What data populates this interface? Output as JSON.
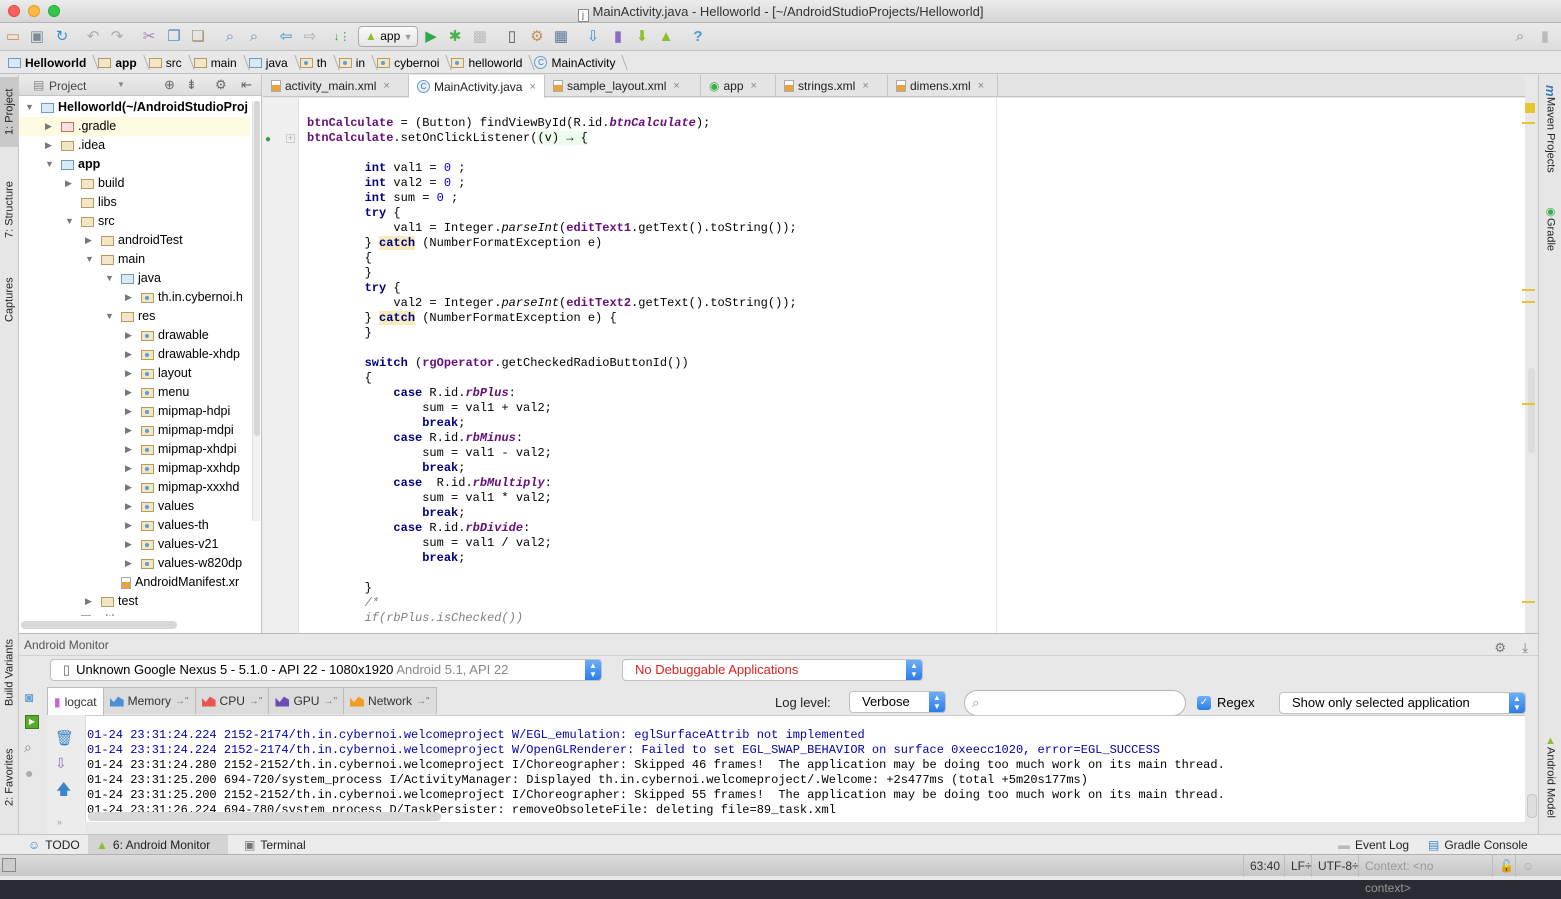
{
  "window": {
    "title": "MainActivity.java - Helloworld - [~/AndroidStudioProjects/Helloworld]",
    "traffic_lights": {
      "close": "#fc605c",
      "minimize": "#fdbc40",
      "maximize": "#34c84a"
    }
  },
  "toolbar": {
    "run_config": "app",
    "icons": [
      "open-folder-icon",
      "save-icon",
      "sync-icon",
      "undo-icon",
      "redo-icon",
      "cut-icon",
      "copy-icon",
      "paste-icon",
      "find-icon",
      "replace-icon",
      "back-icon",
      "forward-icon",
      "make-project-icon",
      "run-icon",
      "debug-icon",
      "coverage-icon",
      "attach-debugger-icon",
      "project-structure-icon",
      "sdk-manager-icon",
      "gradle-sync-icon",
      "avd-manager-icon",
      "android-device-monitor-icon",
      "android-icon",
      "help-icon",
      "search-everywhere-icon",
      "user-icon"
    ]
  },
  "breadcrumb": [
    "Helloworld",
    "app",
    "src",
    "main",
    "java",
    "th",
    "in",
    "cybernoi",
    "helloworld",
    "MainActivity"
  ],
  "project_panel": {
    "view_selector": "Project",
    "tree": [
      {
        "label": "Helloworld",
        "suffix": " (~/AndroidStudioProj",
        "depth": 0,
        "expanded": true,
        "bold": true,
        "icon": "module"
      },
      {
        "label": ".gradle",
        "depth": 1,
        "expanded": false,
        "icon": "folder-red",
        "selected": true
      },
      {
        "label": ".idea",
        "depth": 1,
        "expanded": false,
        "icon": "folder"
      },
      {
        "label": "app",
        "depth": 1,
        "expanded": true,
        "bold": true,
        "icon": "module"
      },
      {
        "label": "build",
        "depth": 2,
        "expanded": false,
        "icon": "folder"
      },
      {
        "label": "libs",
        "depth": 2,
        "expanded": null,
        "icon": "folder"
      },
      {
        "label": "src",
        "depth": 2,
        "expanded": true,
        "icon": "folder"
      },
      {
        "label": "androidTest",
        "depth": 3,
        "expanded": false,
        "icon": "folder"
      },
      {
        "label": "main",
        "depth": 3,
        "expanded": true,
        "icon": "folder"
      },
      {
        "label": "java",
        "depth": 4,
        "expanded": true,
        "icon": "folder-blue"
      },
      {
        "label": "th.in.cybernoi.h",
        "depth": 5,
        "expanded": false,
        "icon": "package"
      },
      {
        "label": "res",
        "depth": 4,
        "expanded": true,
        "icon": "folder-res"
      },
      {
        "label": "drawable",
        "depth": 5,
        "expanded": false,
        "icon": "package"
      },
      {
        "label": "drawable-xhdp",
        "depth": 5,
        "expanded": false,
        "icon": "package"
      },
      {
        "label": "layout",
        "depth": 5,
        "expanded": false,
        "icon": "package"
      },
      {
        "label": "menu",
        "depth": 5,
        "expanded": false,
        "icon": "package"
      },
      {
        "label": "mipmap-hdpi",
        "depth": 5,
        "expanded": false,
        "icon": "package"
      },
      {
        "label": "mipmap-mdpi",
        "depth": 5,
        "expanded": false,
        "icon": "package"
      },
      {
        "label": "mipmap-xhdpi",
        "depth": 5,
        "expanded": false,
        "icon": "package"
      },
      {
        "label": "mipmap-xxhdp",
        "depth": 5,
        "expanded": false,
        "icon": "package"
      },
      {
        "label": "mipmap-xxxhd",
        "depth": 5,
        "expanded": false,
        "icon": "package"
      },
      {
        "label": "values",
        "depth": 5,
        "expanded": false,
        "icon": "package"
      },
      {
        "label": "values-th",
        "depth": 5,
        "expanded": false,
        "icon": "package"
      },
      {
        "label": "values-v21",
        "depth": 5,
        "expanded": false,
        "icon": "package"
      },
      {
        "label": "values-w820dp",
        "depth": 5,
        "expanded": false,
        "icon": "package"
      },
      {
        "label": "AndroidManifest.xr",
        "depth": 4,
        "expanded": null,
        "icon": "xml"
      },
      {
        "label": "test",
        "depth": 3,
        "expanded": false,
        "icon": "folder"
      },
      {
        "label": ".gitignore",
        "depth": 2,
        "expanded": null,
        "icon": "file"
      }
    ]
  },
  "left_strip": [
    "1: Project",
    "7: Structure",
    "Captures",
    "Build Variants",
    "2: Favorites"
  ],
  "right_strip": [
    "Maven Projects",
    "Gradle",
    "Android Model"
  ],
  "editor": {
    "tabs": [
      {
        "label": "activity_main.xml",
        "icon": "xml",
        "active": false
      },
      {
        "label": "MainActivity.java",
        "icon": "class",
        "active": true
      },
      {
        "label": "sample_layout.xml",
        "icon": "xml",
        "active": false
      },
      {
        "label": "app",
        "icon": "gradle",
        "active": false
      },
      {
        "label": "strings.xml",
        "icon": "xml",
        "active": false
      },
      {
        "label": "dimens.xml",
        "icon": "xml",
        "active": false
      }
    ],
    "code_lines": [
      "btnCalculate = (Button) findViewById(R.id.btnCalculate);",
      "btnCalculate.setOnClickListener((v) → {",
      "",
      "        int val1 = 0 ;",
      "        int val2 = 0 ;",
      "        int sum = 0 ;",
      "        try {",
      "            val1 = Integer.parseInt(editText1.getText().toString());",
      "        } catch (NumberFormatException e)",
      "        {",
      "        }",
      "        try {",
      "            val2 = Integer.parseInt(editText2.getText().toString());",
      "        } catch (NumberFormatException e) {",
      "        }",
      "",
      "        switch (rgOperator.getCheckedRadioButtonId())",
      "        {",
      "            case R.id.rbPlus:",
      "                sum = val1 + val2;",
      "                break;",
      "            case R.id.rbMinus:",
      "                sum = val1 - val2;",
      "                break;",
      "            case  R.id.rbMultiply:",
      "                sum = val1 * val2;",
      "                break;",
      "            case R.id.rbDivide:",
      "                sum = val1 / val2;",
      "                break;",
      "",
      "        }",
      "        /*",
      "        if(rbPlus.isChecked())"
    ],
    "marker_color": "#e8c42f"
  },
  "android_monitor": {
    "title": "Android Monitor",
    "device": "Unknown Google Nexus 5 - 5.1.0 - API 22 - 1080x1920",
    "device_suffix": "Android 5.1, API 22",
    "process": "No Debuggable Applications",
    "process_color": "#e0231d",
    "tabs": [
      {
        "label": "logcat",
        "active": true
      },
      {
        "label": "Memory",
        "color": "#4a90d9"
      },
      {
        "label": "CPU",
        "color": "#e8574f"
      },
      {
        "label": "GPU",
        "color": "#6a4fb3"
      },
      {
        "label": "Network",
        "color": "#f39c1f"
      }
    ],
    "log_level_label": "Log level:",
    "log_level": "Verbose",
    "search_placeholder": "",
    "regex_label": "Regex",
    "regex_checked": true,
    "filter": "Show only selected application",
    "log_lines": [
      {
        "level": "W",
        "text": "01-24 23:31:24.224 2152-2174/th.in.cybernoi.welcomeproject W/EGL_emulation: eglSurfaceAttrib not implemented"
      },
      {
        "level": "W",
        "text": "01-24 23:31:24.224 2152-2174/th.in.cybernoi.welcomeproject W/OpenGLRenderer: Failed to set EGL_SWAP_BEHAVIOR on surface 0xeecc1020, error=EGL_SUCCESS"
      },
      {
        "level": "I",
        "text": "01-24 23:31:24.280 2152-2152/th.in.cybernoi.welcomeproject I/Choreographer: Skipped 46 frames!  The application may be doing too much work on its main thread."
      },
      {
        "level": "I",
        "text": "01-24 23:31:25.200 694-720/system_process I/ActivityManager: Displayed th.in.cybernoi.welcomeproject/.Welcome: +2s477ms (total +5m20s177ms)"
      },
      {
        "level": "I",
        "text": "01-24 23:31:25.200 2152-2152/th.in.cybernoi.welcomeproject I/Choreographer: Skipped 55 frames!  The application may be doing too much work on its main thread."
      },
      {
        "level": "D",
        "text": "01-24 23:31:26.224 694-780/system_process D/TaskPersister: removeObsoleteFile: deleting file=89_task.xml"
      }
    ]
  },
  "bottom_tools": {
    "todo": "TODO",
    "android_monitor": "6: Android Monitor",
    "terminal": "Terminal",
    "event_log": "Event Log",
    "gradle_console": "Gradle Console"
  },
  "status_bar": {
    "position": "63:40",
    "line_sep": "LF÷",
    "encoding": "UTF-8÷",
    "context": "Context: <no context>"
  }
}
